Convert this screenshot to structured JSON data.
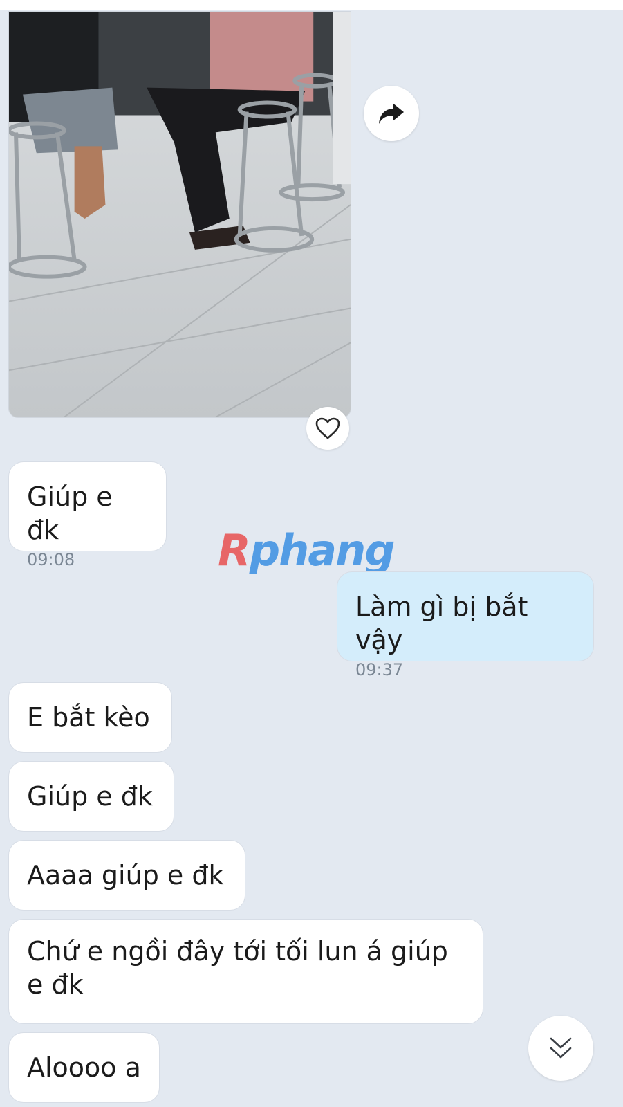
{
  "messages": [
    {
      "text": "Giúp e đk",
      "time": "09:08",
      "direction": "incoming"
    },
    {
      "text": "Làm gì bị bắt vậy",
      "time": "09:37",
      "direction": "outgoing"
    },
    {
      "text": "E bắt kèo",
      "direction": "incoming"
    },
    {
      "text": "Giúp e đk",
      "direction": "incoming"
    },
    {
      "text": "Aaaa giúp e đk",
      "direction": "incoming"
    },
    {
      "text": "Chứ e ngồi đây tới tối lun á giúp e đk",
      "direction": "incoming"
    },
    {
      "text": "Aloooo a",
      "direction": "incoming"
    }
  ],
  "watermark": {
    "part1": "R",
    "part2": "phang"
  },
  "icons": {
    "share": "share-arrow-icon",
    "like": "heart-icon",
    "scroll": "double-chevron-down-icon"
  },
  "colors": {
    "background": "#e3e9f1",
    "incoming": "#ffffff",
    "outgoing": "#d4edfb",
    "time": "#7b8794"
  }
}
